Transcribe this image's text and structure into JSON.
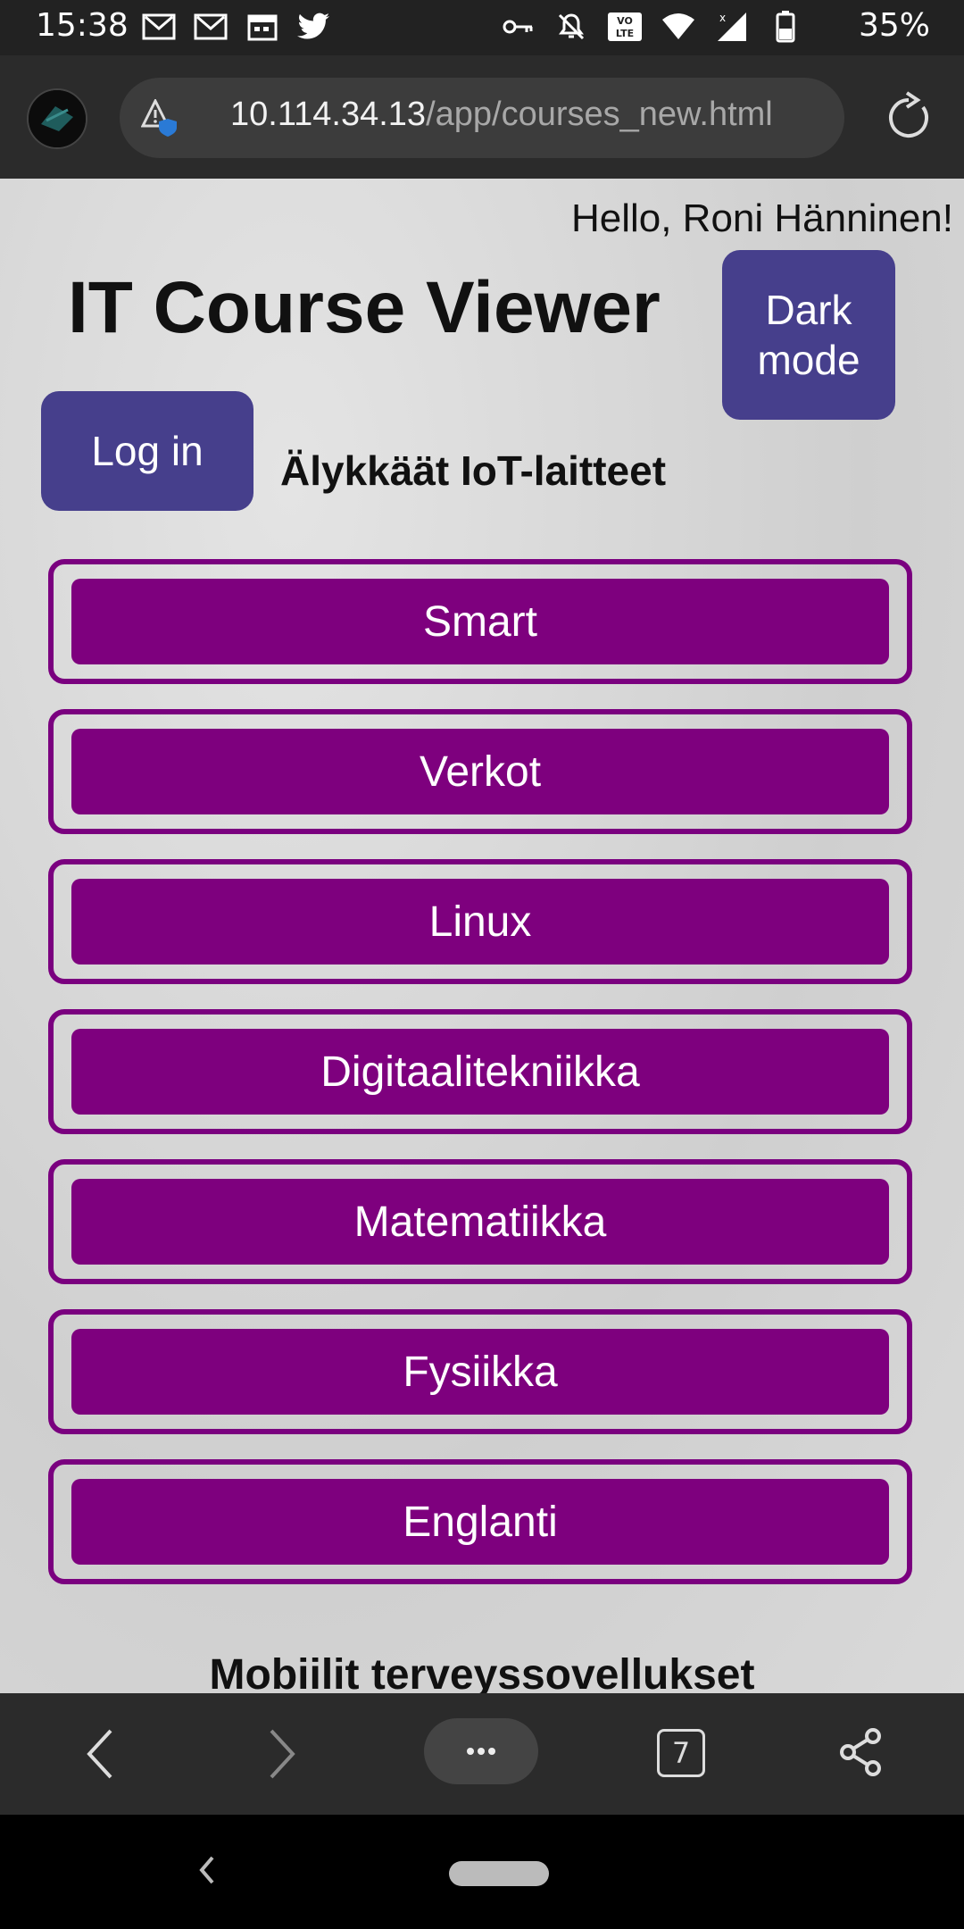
{
  "status_bar": {
    "time": "15:38",
    "left_icons": [
      "gmail-icon",
      "gmail-icon",
      "calendar-icon",
      "twitter-icon"
    ],
    "right_icons": [
      "vpn-key-icon",
      "bell-off-icon",
      "volte-icon",
      "wifi-icon",
      "signal-icon",
      "battery-icon"
    ],
    "volte_label": "VO\nLTE",
    "battery": "35%"
  },
  "browser": {
    "url_host": "10.114.34.13",
    "url_path": "/app/courses_new.html"
  },
  "page": {
    "greeting": "Hello, Roni Hänninen!",
    "title": "IT Course Viewer",
    "dark_mode_label": "Dark mode",
    "login_label": "Log in",
    "section_title": "Älykkäät IoT-laitteet",
    "courses": [
      "Smart",
      "Verkot",
      "Linux",
      "Digitaalitekniikka",
      "Matematiikka",
      "Fysiikka",
      "Englanti"
    ],
    "next_section_title": "Mobiilit terveyssovellukset"
  },
  "bottom_nav": {
    "menu_label": "···",
    "tab_count": "7"
  },
  "colors": {
    "primary_button": "#463f8c",
    "course_button": "#7e007e",
    "course_border": "#7a007f"
  }
}
